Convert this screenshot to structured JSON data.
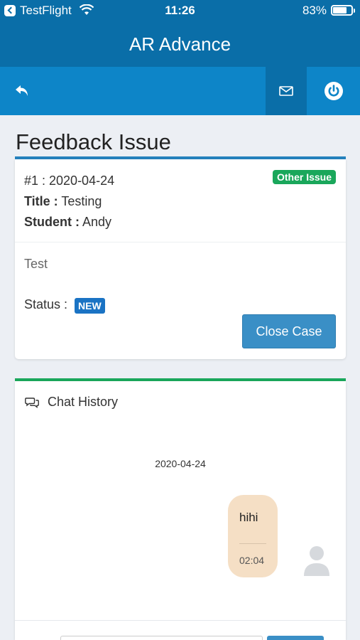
{
  "status_bar": {
    "back_app": "TestFlight",
    "time": "11:26",
    "battery_pct": "83%",
    "battery_level": 0.83
  },
  "header": {
    "title": "AR Advance"
  },
  "toolbar": {
    "back_icon": "reply-arrow-icon",
    "mail_icon": "envelope-icon",
    "power_icon": "power-icon"
  },
  "page": {
    "title": "Feedback Issue"
  },
  "issue": {
    "case_number": "#1 : 2020-04-24",
    "type_badge": "Other Issue",
    "title_label": "Title :",
    "title_value": "Testing",
    "student_label": "Student :",
    "student_value": "Andy",
    "description": "Test",
    "status_label": "Status :",
    "status_value": "NEW",
    "close_button": "Close Case"
  },
  "chat": {
    "heading": "Chat History",
    "date": "2020-04-24",
    "messages": [
      {
        "text": "hihi",
        "time": "02:04"
      }
    ],
    "input_placeholder": ""
  },
  "colors": {
    "header_dark": "#0a6ea8",
    "toolbar": "#0d85c8",
    "accent_green": "#1aa75b",
    "button_blue": "#3a8fc6",
    "bubble": "#f5dfc5"
  }
}
